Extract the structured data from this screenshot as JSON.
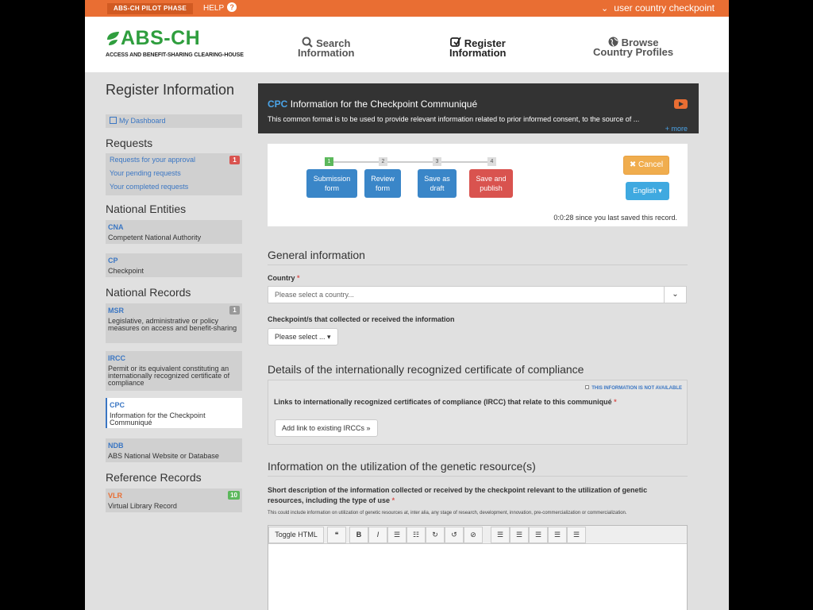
{
  "topbar": {
    "pilot": "ABS-CH PILOT PHASE",
    "help": "HELP",
    "help_icon": "?",
    "user_menu": "user country checkpoint",
    "chevron": "⌄"
  },
  "header": {
    "logo": "ABS-CH",
    "logo_sub": "ACCESS AND BENEFIT-SHARING CLEARING-HOUSE",
    "nav": [
      {
        "line1": "Search",
        "line2": "Information",
        "icon": "search-icon"
      },
      {
        "line1": "Register",
        "line2": "Information",
        "icon": "edit-icon"
      },
      {
        "line1": "Browse",
        "line2": "Country Profiles",
        "icon": "globe-icon"
      }
    ]
  },
  "sidebar": {
    "title": "Register Information",
    "dashboard": "My Dashboard",
    "requests_heading": "Requests",
    "requests": [
      {
        "label": "Requests for your approval",
        "badge": "1"
      },
      {
        "label": "Your pending requests"
      },
      {
        "label": "Your completed requests"
      }
    ],
    "national_entities_heading": "National Entities",
    "national_entities": [
      {
        "code": "CNA",
        "desc": "Competent National Authority"
      },
      {
        "code": "CP",
        "desc": "Checkpoint"
      }
    ],
    "national_records_heading": "National Records",
    "national_records": [
      {
        "code": "MSR",
        "desc": "Legislative, administrative or policy measures on access and benefit-sharing",
        "badge": "1"
      },
      {
        "code": "IRCC",
        "desc": "Permit or its equivalent constituting an internationally recognized certificate of compliance"
      },
      {
        "code": "CPC",
        "desc": "Information for the Checkpoint Communiqué"
      },
      {
        "code": "NDB",
        "desc": "ABS National Website or Database"
      }
    ],
    "reference_heading": "Reference Records",
    "reference": [
      {
        "code": "VLR",
        "desc": "Virtual Library Record",
        "badge": "10"
      }
    ]
  },
  "main": {
    "cpc_tag": "CPC",
    "cpc_title": "Information for the Checkpoint Communiqué",
    "cpc_desc": "This common format is to be used to provide relevant information related to prior informed consent, to the source of ...",
    "more": "+ more",
    "steps": [
      {
        "num": "1",
        "label1": "Submission",
        "label2": "form"
      },
      {
        "num": "2",
        "label1": "Review",
        "label2": "form"
      },
      {
        "num": "3",
        "label1": "Save as",
        "label2": "draft"
      },
      {
        "num": "4",
        "label1": "Save and",
        "label2": "publish"
      }
    ],
    "cancel": "✖ Cancel",
    "language": "English ▾",
    "saved": "0:0:28 since you last saved this record.",
    "general_title": "General information",
    "country_label": "Country",
    "required_mark": "*",
    "country_placeholder": "Please select a country...",
    "select_arrow": "⌄",
    "checkpoints_label": "Checkpoint/s that collected or received the information",
    "please_select": "Please select ... ▾",
    "ircc_title": "Details of the internationally recognized certificate of compliance",
    "not_available": "THIS INFORMATION IS NOT AVAILABLE",
    "ircc_links_label": "Links to internationally recognized certificates of compliance (IRCC) that relate to this communiqué",
    "add_link": "Add link to existing IRCCs »",
    "util_title": "Information on the utilization of the genetic resource(s)",
    "short_desc_label": "Short description of the information collected or received by the checkpoint relevant to the utilization of genetic resources, including the type of use",
    "hint": "This could include information on utilization of genetic resources at, inter alia, any stage of research, development, innovation, pre-commercialization or commercialization.",
    "toolbar": {
      "toggle_html": "Toggle HTML",
      "buttons": [
        "❝",
        "B",
        "I",
        "☰",
        "☷",
        "↻",
        "↺",
        "⊘",
        "☰",
        "☰",
        "☰",
        "☰",
        "☰"
      ]
    }
  },
  "colors": {
    "orange": "#e96e33",
    "green": "#2f9e3e",
    "blue": "#3a76c3",
    "step_blue": "#3a86c8",
    "step_red": "#d9534f"
  }
}
